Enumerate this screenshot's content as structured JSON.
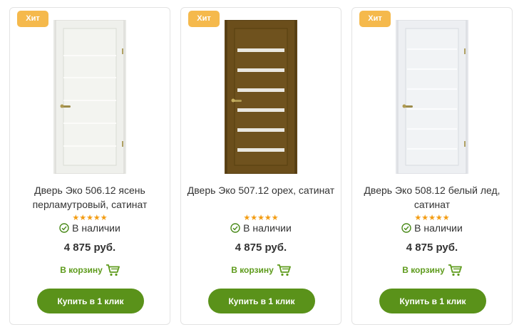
{
  "colors": {
    "badge": "#f5b94c",
    "stars": "#f39c12",
    "accent_green": "#5a921a",
    "cart_text": "#5e9b1c"
  },
  "products": [
    {
      "badge": "Хит",
      "door_color": "white-ash",
      "title": "Дверь Эко 506.12 ясень перламутровый, сатинат",
      "rating": "★★★★★",
      "stock": "В наличии",
      "price": "4 875 руб.",
      "cart_label": "В корзину",
      "buy_label": "Купить в 1 клик"
    },
    {
      "badge": "Хит",
      "door_color": "walnut",
      "title": "Дверь Эко 507.12 орех, сатинат",
      "rating": "★★★★★",
      "stock": "В наличии",
      "price": "4 875 руб.",
      "cart_label": "В корзину",
      "buy_label": "Купить в 1 клик"
    },
    {
      "badge": "Хит",
      "door_color": "white-ice",
      "title": "Дверь Эко 508.12 белый лед, сатинат",
      "rating": "★★★★★",
      "stock": "В наличии",
      "price": "4 875 руб.",
      "cart_label": "В корзину",
      "buy_label": "Купить в 1 клик"
    }
  ]
}
